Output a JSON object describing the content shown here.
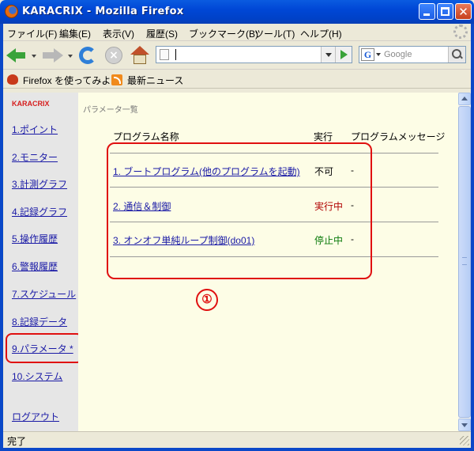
{
  "window": {
    "title": "KARACRIX - Mozilla Firefox"
  },
  "menu": [
    "ファイル(F)",
    "編集(E)",
    "表示(V)",
    "履歴(S)",
    "ブックマーク(B)",
    "ツール(T)",
    "ヘルプ(H)"
  ],
  "search": {
    "placeholder": "Google"
  },
  "bookmarks": [
    "Firefox を使ってみよう",
    "最新ニュース"
  ],
  "sidebar": {
    "brand": "KARACRIX",
    "items": [
      "1.ポイント",
      "2.モニター",
      "3.計測グラフ",
      "4.記録グラフ",
      "5.操作履歴",
      "6.警報履歴",
      "7.スケジュール",
      "8.記録データ",
      "9.パラメータ *",
      "10.システム"
    ],
    "logout": "ログアウト"
  },
  "main": {
    "breadcrumb": "パラメータ一覧",
    "columns": [
      "プログラム名称",
      "実行",
      "プログラムメッセージ"
    ],
    "rows": [
      {
        "name": "1. ブートプログラム(他のプログラムを起動)",
        "status": "不可",
        "status_color": "#000000",
        "message": "-"
      },
      {
        "name": "2. 通信＆制御",
        "status": "実行中",
        "status_color": "#b00000",
        "message": "-"
      },
      {
        "name": "3. オンオフ単純ループ制御(do01)",
        "status": "停止中",
        "status_color": "#0a7a0a",
        "message": "-"
      }
    ],
    "callout": "①"
  },
  "status": {
    "text": "完了"
  },
  "colors": {
    "annotation": "#e01010",
    "link": "#1a1aa6"
  }
}
